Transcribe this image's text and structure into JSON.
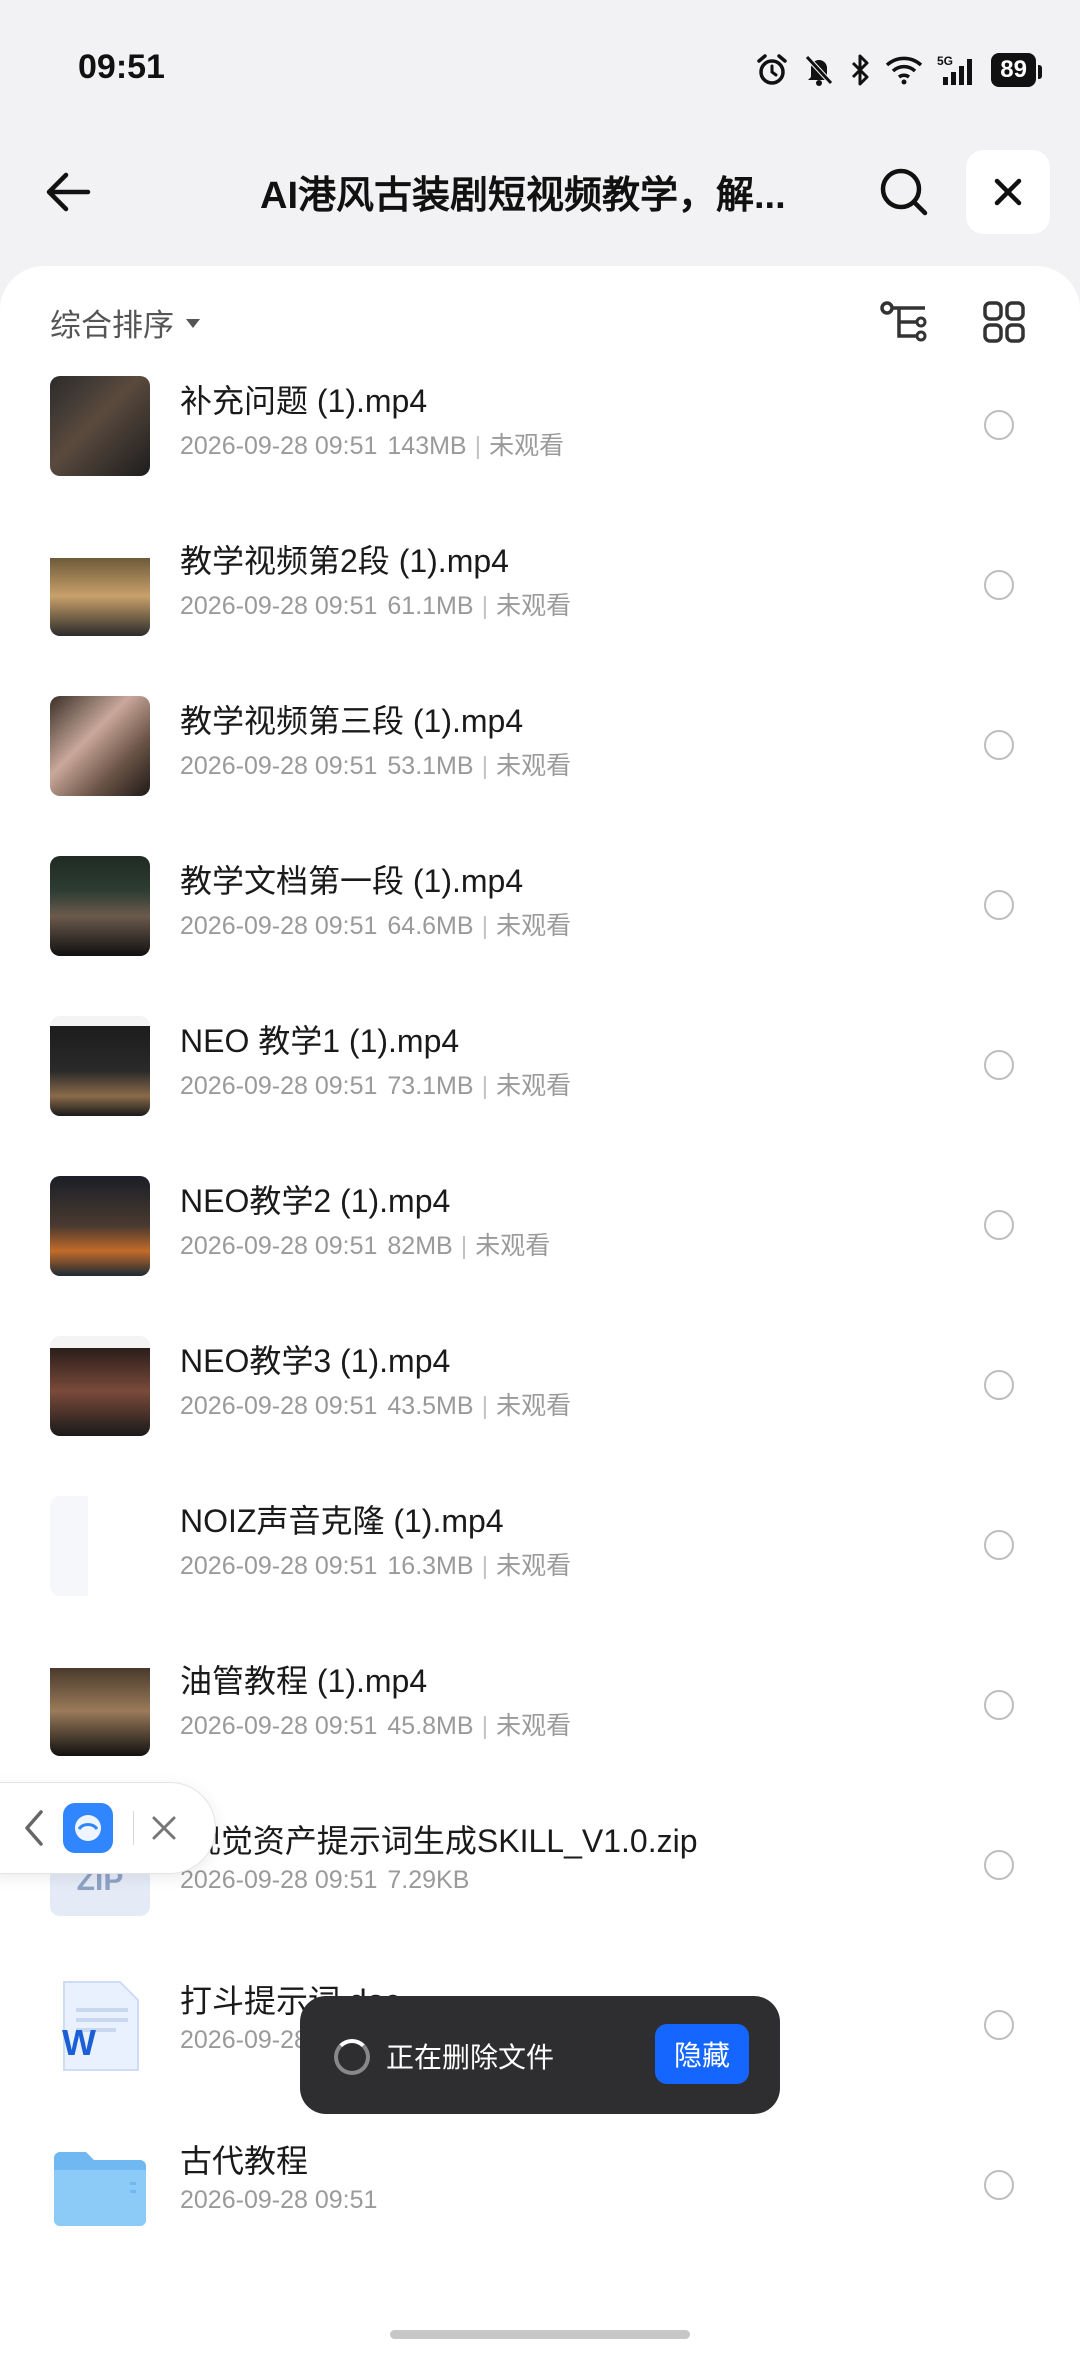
{
  "status_bar": {
    "time": "09:51",
    "network": "5G",
    "battery": "89"
  },
  "header": {
    "title": "AI港风古装剧短视频教学，解...",
    "back_icon": "arrow-left-icon",
    "search_icon": "search-icon",
    "close_icon": "close-icon"
  },
  "toolbar": {
    "sort_label": "综合排序",
    "sort_icon": "caret-down-icon",
    "tree_icon": "tree-view-icon",
    "grid_icon": "grid-view-icon"
  },
  "files": [
    {
      "name": "补充问题 (1).mp4",
      "date": "2026-09-28 09:51",
      "size": "143MB",
      "status": "未观看",
      "thumb": "video"
    },
    {
      "name": "教学视频第2段 (1).mp4",
      "date": "2026-09-28 09:51",
      "size": "61.1MB",
      "status": "未观看",
      "thumb": "video"
    },
    {
      "name": "教学视频第三段 (1).mp4",
      "date": "2026-09-28 09:51",
      "size": "53.1MB",
      "status": "未观看",
      "thumb": "video"
    },
    {
      "name": "教学文档第一段 (1).mp4",
      "date": "2026-09-28 09:51",
      "size": "64.6MB",
      "status": "未观看",
      "thumb": "video"
    },
    {
      "name": "NEO 教学1 (1).mp4",
      "date": "2026-09-28 09:51",
      "size": "73.1MB",
      "status": "未观看",
      "thumb": "video"
    },
    {
      "name": "NEO教学2 (1).mp4",
      "date": "2026-09-28 09:51",
      "size": "82MB",
      "status": "未观看",
      "thumb": "video"
    },
    {
      "name": "NEO教学3 (1).mp4",
      "date": "2026-09-28 09:51",
      "size": "43.5MB",
      "status": "未观看",
      "thumb": "video"
    },
    {
      "name": "NOIZ声音克隆 (1).mp4",
      "date": "2026-09-28 09:51",
      "size": "16.3MB",
      "status": "未观看",
      "thumb": "video"
    },
    {
      "name": "油管教程 (1).mp4",
      "date": "2026-09-28 09:51",
      "size": "45.8MB",
      "status": "未观看",
      "thumb": "video"
    },
    {
      "name": ".视觉资产提示词生成SKILL_V1.0.zip",
      "date": "2026-09-28 09:51",
      "size": "7.29KB",
      "status": "",
      "thumb": "zip",
      "thumb_label": "ZIP"
    },
    {
      "name": "打斗提示词.doc",
      "date": "2026-09-28 09:51",
      "size": "",
      "status": "",
      "thumb": "doc",
      "thumb_label": "W"
    },
    {
      "name": "古代教程",
      "date": "2026-09-28 09:51",
      "size": "",
      "status": "",
      "thumb": "folder"
    }
  ],
  "toast": {
    "message": "正在删除文件",
    "hide_label": "隐藏"
  },
  "floating_widget": {
    "back_icon": "chevron-left-icon",
    "app_icon": "assistant-app-icon",
    "close_icon": "close-icon"
  },
  "colors": {
    "accent": "#1466ff",
    "toast_bg": "#2e2e30",
    "panel_bg": "#ffffff",
    "page_bg": "#f2f2f4"
  }
}
